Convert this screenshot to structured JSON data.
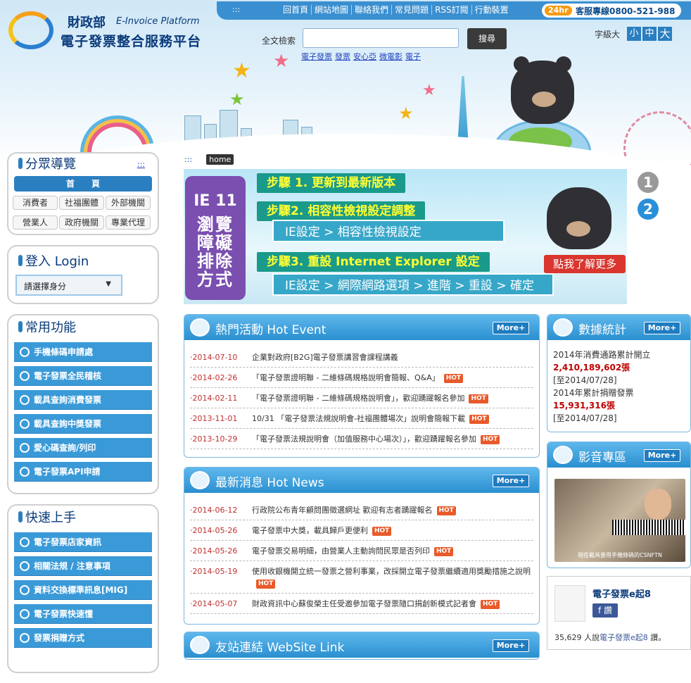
{
  "topbar": {
    "dots": ":::",
    "links": [
      "回首頁",
      "網站地圖",
      "聯絡我們",
      "常見問題",
      "RSS訂閱",
      "行動裝置"
    ],
    "hotline_badge": "24hr",
    "hotline_text": "客服專線0800-521-988"
  },
  "logo": {
    "ministry": "財政部",
    "english": "E-Invoice Platform",
    "name": "電子發票整合服務平台"
  },
  "search": {
    "label": "全文檢索",
    "value": "",
    "button": "搜尋",
    "keywords": [
      "電子發票",
      "發票",
      "安心亞",
      "微電影",
      "電子"
    ]
  },
  "fontsize": {
    "label": "字級大",
    "small": "小",
    "medium": "中",
    "large": "大"
  },
  "breadcrumb": {
    "dots": ":::",
    "home": "home"
  },
  "sidebar": {
    "nav": {
      "title": "分眾導覽",
      "dots": ":::",
      "home": "首　　頁",
      "roles": [
        "消費者",
        "社福團體",
        "外部機關",
        "營業人",
        "政府機關",
        "專業代理"
      ]
    },
    "login": {
      "title": "登入 Login",
      "select_value": "請選擇身分",
      "arrow": "▼"
    },
    "common": {
      "title": "常用功能",
      "items": [
        "手機條碼申請處",
        "電子發票全民稽核",
        "載具查詢消費發票",
        "載具查詢中獎發票",
        "愛心碼查詢/列印",
        "電子發票API申請"
      ]
    },
    "quick": {
      "title": "快速上手",
      "items": [
        "電子發票店家資訊",
        "相關法規 / 注意事項",
        "資料交換標準訊息[MIG]",
        "電子發票快速懂",
        "發票捐贈方式"
      ]
    }
  },
  "banner": {
    "browser": "IE 11",
    "vertical_title": "瀏覽障礙排除方式",
    "steps": [
      "步驟 1. 更新到最新版本",
      "步驟2. 相容性檢視設定調整",
      "步驟3. 重設 Internet Explorer 設定"
    ],
    "subs": [
      "IE設定 > 相容性檢視設定",
      "IE設定 > 網際網路選項 > 進階 > 重設 > 確定"
    ],
    "cta": "點我了解更多",
    "pager": [
      "1",
      "2"
    ]
  },
  "hot_event": {
    "title": "熱門活動 Hot Event",
    "more": "More+",
    "hot_label": "HOT",
    "rows": [
      {
        "date": "·2014-07-10",
        "text": "企業對政府[B2G]電子發票講習會課程講義",
        "hot": false
      },
      {
        "date": "·2014-02-26",
        "text": "「電子發票證明聯 - 二維條碼規格說明會簡報、Q&A」",
        "hot": true
      },
      {
        "date": "·2014-02-11",
        "text": "「電子發票證明聯 - 二維條碼規格說明會」，歡迎踴躍報名參加",
        "hot": true
      },
      {
        "date": "·2013-11-01",
        "text": "10/31 「電子發票法規說明會-社福團體場次」說明會簡報下載",
        "hot": true
      },
      {
        "date": "·2013-10-29",
        "text": "「電子發票法規說明會（加值服務中心場次）」，歡迎踴躍報名參加",
        "hot": true
      }
    ]
  },
  "hot_news": {
    "title": "最新消息 Hot News",
    "more": "More+",
    "hot_label": "HOT",
    "rows": [
      {
        "date": "·2014-06-12",
        "text": "行政院公布青年顧問團徵選網址 歡迎有志者踴躍報名",
        "hot": true
      },
      {
        "date": "·2014-05-26",
        "text": "電子發票中大獎，載具歸戶更便利",
        "hot": true
      },
      {
        "date": "·2014-05-26",
        "text": "電子發票交易明細，由營業人主動詢問民眾是否列印",
        "hot": true
      },
      {
        "date": "·2014-05-19",
        "text": "使用收銀機開立統一發票之營利事業，改採開立電子發票繼續適用獎勵措施之說明",
        "hot": true
      },
      {
        "date": "·2014-05-07",
        "text": "財政資訊中心蘇俊榮主任受邀參加電子發票隨口捐創新模式記者會",
        "hot": true
      }
    ]
  },
  "links_box": {
    "title": "友站連結 WebSite Link",
    "more": "More+"
  },
  "stats": {
    "title": "數據統計",
    "more": "More+",
    "l1": "2014年消費通路累計開立",
    "v1": "2,410,189,602張",
    "d1": "[至2014/07/28]",
    "l2": "2014年累計捐贈發票",
    "v2": "15,931,316張",
    "d2": "[至2014/07/28]"
  },
  "media": {
    "title": "影音專區",
    "more": "More+",
    "caption": "現在載具要用手機條碼的CSNFTN"
  },
  "facebook": {
    "name": "電子發票e起8",
    "like": "讚",
    "count_prefix": "35,629 人說",
    "count_name": "電子發票e起8",
    "count_suffix": " 讚。"
  },
  "colors": {
    "primary": "#2a7fc0",
    "header_bar": "#3a8fd0",
    "date_red": "#c03030",
    "hot": "#e85a2a",
    "banner_purple": "#7a4fb0",
    "banner_step": "#1a9a8a",
    "cta": "#d8362e",
    "pager_active": "#2a8fd8",
    "pager_inactive": "#999999"
  }
}
